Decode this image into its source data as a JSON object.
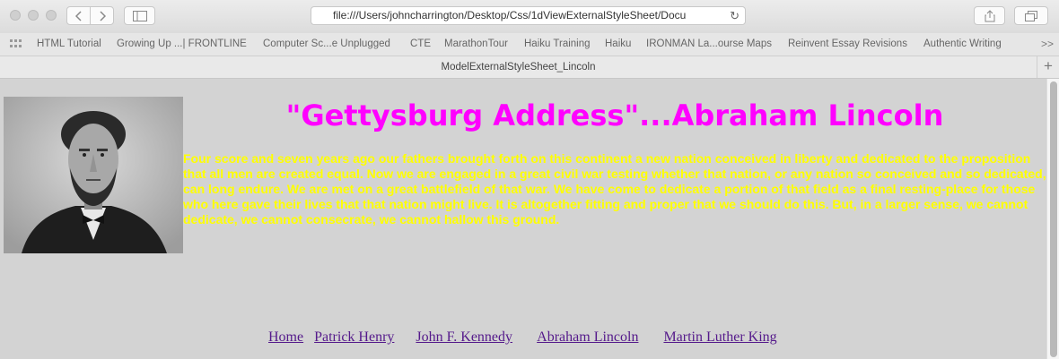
{
  "browser": {
    "address": "file:///Users/johncharrington/Desktop/Css/1dViewExternalStyleSheet/Docu",
    "tab_title": "ModelExternalStyleSheet_Lincoln",
    "bookmarks": [
      "HTML Tutorial",
      "Growing Up ...| FRONTLINE",
      "Computer Sc...e Unplugged",
      "CTE",
      "MarathonTour",
      "Haiku Training",
      "Haiku",
      "IRONMAN La...ourse Maps",
      "Reinvent Essay Revisions",
      "Authentic Writing"
    ],
    "bookmarks_more": ">>"
  },
  "page": {
    "heading": "\"Gettysburg Address\"...Abraham Lincoln",
    "speech": "Four score and seven years ago our fathers brought forth on this continent a new nation conceived in liberty and dedicated to the proposition that all men are created equal. Now we are engaged in a great civil war testing whether that nation, or any nation so conceived and so dedicated, can long endure. We are met on a great battlefield of that war. We have come to dedicate a portion of that field as a final resting-place for those who here gave their lives that that nation might live. It is altogether fitting and proper that we should do this. But, in a larger sense, we cannot dedicate, we cannot consecrate, we cannot hallow this ground.",
    "nav_links": [
      "Home",
      "Patrick Henry",
      "John F. Kennedy",
      "Abraham Lincoln",
      "Martin Luther King"
    ]
  },
  "colors": {
    "page_background": "#d3d3d3",
    "heading": "#ff00ff",
    "speech_text": "#ffff00",
    "link": "#551a8b"
  }
}
